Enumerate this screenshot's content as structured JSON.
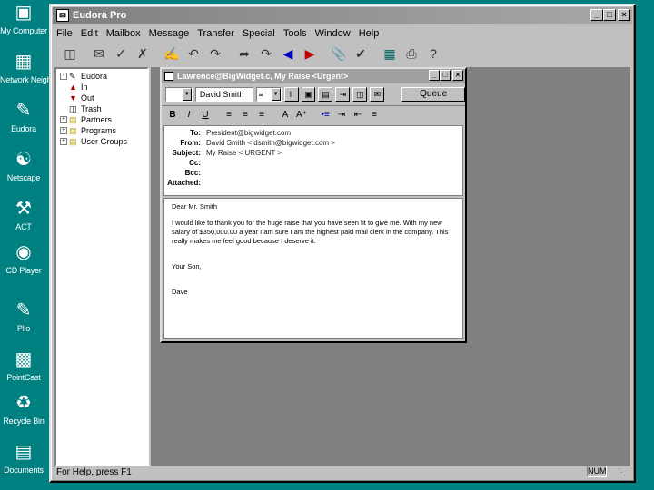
{
  "desktop": {
    "icons": [
      {
        "label": "My Computer",
        "icon": "computer-icon"
      },
      {
        "label": "Network Neighborhood",
        "icon": "network-icon"
      },
      {
        "label": "Eudora",
        "icon": "eudora-icon"
      },
      {
        "label": "Netscape",
        "icon": "netscape-icon"
      },
      {
        "label": "ACT",
        "icon": "act-icon"
      },
      {
        "label": "CD Player",
        "icon": "cd-player-icon"
      },
      {
        "label": "Plio",
        "icon": "plio-icon"
      },
      {
        "label": "PointCast",
        "icon": "pointcast-icon"
      },
      {
        "label": "Recycle Bin",
        "icon": "recycle-bin-icon"
      },
      {
        "label": "Documents",
        "icon": "documents-folder-icon"
      }
    ]
  },
  "app": {
    "title": "Eudora Pro",
    "menu": [
      "File",
      "Edit",
      "Mailbox",
      "Message",
      "Transfer",
      "Special",
      "Tools",
      "Window",
      "Help"
    ]
  },
  "folders": [
    {
      "label": "Eudora",
      "level": 0,
      "expand": "-"
    },
    {
      "label": "In",
      "level": 1,
      "expand": ""
    },
    {
      "label": "Out",
      "level": 1,
      "expand": ""
    },
    {
      "label": "Trash",
      "level": 1,
      "expand": ""
    },
    {
      "label": "Partners",
      "level": 1,
      "expand": "+"
    },
    {
      "label": "Programs",
      "level": 1,
      "expand": "+"
    },
    {
      "label": "User Groups",
      "level": 1,
      "expand": "+"
    }
  ],
  "message": {
    "title": "Lawrence@BigWidget.c, My Raise <Urgent>",
    "signature": "David Smith",
    "queue": "Queue",
    "headers": {
      "to_label": "To:",
      "to": "President@bigwidget.com",
      "from_label": "From:",
      "from": "David Smith < dsmith@bigwidget.com >",
      "subject_label": "Subject:",
      "subject": "My Raise < URGENT >",
      "cc_label": "Cc:",
      "bcc_label": "Bcc:",
      "attached_label": "Attached:"
    },
    "body": {
      "greeting": "Dear Mr. Smith",
      "paragraph": "I would like to thank you for the huge raise that you have seen fit to give me. With my new salary of $350,000.00 a year I am sure I am the highest paid mail clerk in the company. This really makes me feel good because I deserve it.",
      "closing": "Your Son,",
      "name": "Dave"
    }
  },
  "status": {
    "help_text": "For Help, press F1",
    "num": "NUM"
  }
}
